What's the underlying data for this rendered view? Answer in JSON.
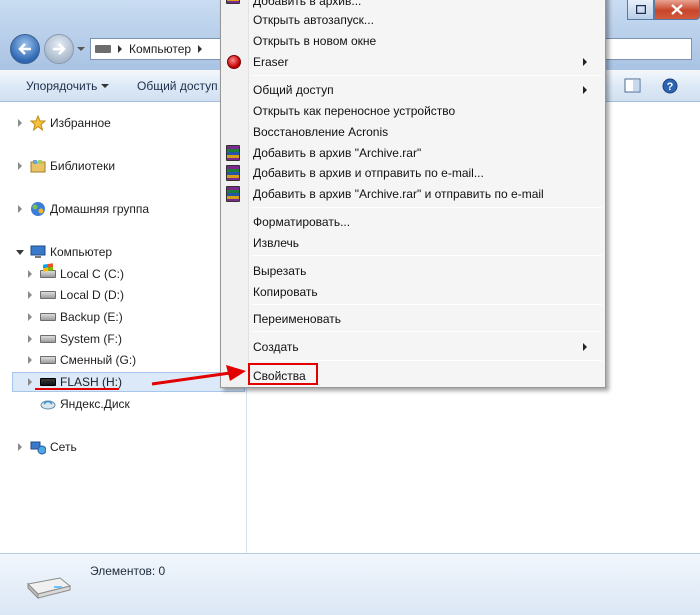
{
  "address": {
    "segment": "Компьютер"
  },
  "toolbar": {
    "organize": "Упорядочить",
    "share": "Общий доступ"
  },
  "sidebar": {
    "favorites": "Избранное",
    "libraries": "Библиотеки",
    "homegroup": "Домашняя группа",
    "computer": "Компьютер",
    "drives": [
      {
        "label": "Local C (C:)"
      },
      {
        "label": "Local D (D:)"
      },
      {
        "label": "Backup (E:)"
      },
      {
        "label": "System (F:)"
      },
      {
        "label": "Сменный (G:)"
      },
      {
        "label": "FLASH (H:)"
      },
      {
        "label": "Яндекс.Диск"
      }
    ],
    "network": "Сеть"
  },
  "context_menu": {
    "items": [
      "Добавить в архив...",
      "Открыть автозапуск...",
      "Открыть в новом окне",
      "Eraser",
      "Общий доступ",
      "Открыть как переносное устройство",
      "Восстановление Acronis",
      "Добавить в архив \"Archive.rar\"",
      "Добавить в архив и отправить по e-mail...",
      "Добавить в архив \"Archive.rar\" и отправить по e-mail",
      "Форматировать...",
      "Извлечь",
      "Вырезать",
      "Копировать",
      "Переименовать",
      "Создать",
      "Свойства"
    ]
  },
  "statusbar": {
    "items_count": "Элементов: 0"
  },
  "colors": {
    "highlight": "#e30000",
    "selection": "#dce9f8"
  },
  "icons": [
    "back-arrow-icon",
    "forward-arrow-icon",
    "star-icon",
    "library-icon",
    "homegroup-icon",
    "computer-icon",
    "drive-icon",
    "flash-drive-icon",
    "yandex-disk-icon",
    "network-icon",
    "winrar-icon",
    "eraser-icon",
    "help-icon"
  ]
}
